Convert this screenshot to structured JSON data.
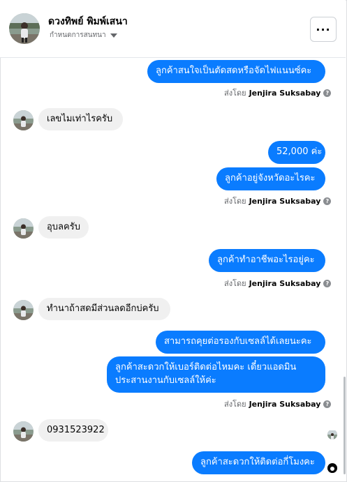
{
  "header": {
    "name": "ดวงทิพย์ พิมพ์เสนา",
    "status": "กำหนดการสนทนา",
    "more_label": "···"
  },
  "sent_by": {
    "prefix": "ส่งโดย",
    "agent": "Jenjira Suksabay",
    "info_icon": "?"
  },
  "messages": {
    "m1": "ลูกค้าสนใจเป็นตัดสดหรือจัดไฟแนนซ์คะ",
    "m2": "เลขไมเท่าไรครับ",
    "m3": "52,000 ค่ะ",
    "m4": "ลูกค้าอยู่จังหวัดอะไรคะ",
    "m5": "อุบลครับ",
    "m6": "ลูกค้าทำอาชีพอะไรอยู่คะ",
    "m7": "ทำนาถ้าสดมีส่วนลดอีกบ่ครับ",
    "m8": "สามารถคุยต่อรองกับเซลล์ได้เลยนะคะ",
    "m9_line1": "ลูกค้าสะดวกให้เบอร์ติดต่อไหมคะ เดี๋ยวแอดมิน",
    "m9_line2": "ประสานงานกับเซลล์ให้ค่ะ",
    "m10": "0931523922",
    "m11": "ลูกค้าสะดวกให้ติดต่อกี่โมงคะ"
  },
  "colors": {
    "outgoing": "#0a7cff",
    "incoming": "#f0f0f0",
    "meta": "#65676b"
  },
  "icons": {
    "more": "more-horizontal-icon",
    "info": "question-icon",
    "status": "caret-down-icon"
  }
}
